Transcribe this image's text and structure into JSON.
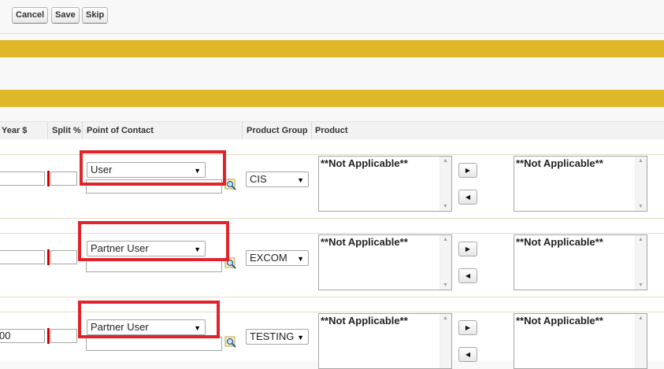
{
  "toolbar": {
    "cancel_label": "Cancel",
    "save_label": "Save",
    "skip_label": "Skip"
  },
  "table": {
    "headers": {
      "year": "Year $",
      "split": "Split %",
      "point_of_contact": "Point of Contact",
      "product_group": "Product Group",
      "product": "Product"
    },
    "rows": [
      {
        "year_value": "",
        "split_value": "",
        "contact_type": "User",
        "contact_value": "",
        "product_group": "CIS",
        "available_products": "**Not Applicable**",
        "selected_products": "**Not Applicable**"
      },
      {
        "year_value": "",
        "split_value": "",
        "contact_type": "Partner User",
        "contact_value": "",
        "product_group": "EXCOM",
        "available_products": "**Not Applicable**",
        "selected_products": "**Not Applicable**"
      },
      {
        "year_value": "00",
        "split_value": "",
        "contact_type": "Partner User",
        "contact_value": "",
        "product_group": "TESTING",
        "available_products": "**Not Applicable**",
        "selected_products": "**Not Applicable**"
      }
    ]
  },
  "icons": {
    "dropdown_arrow": "▼",
    "move_right": "▶",
    "move_left": "◀",
    "scroll_up": "▲",
    "scroll_down": "▼"
  },
  "colors": {
    "section_bar": "#dfb82a",
    "highlight_box": "#e0242c",
    "required_marker": "#cc0000"
  }
}
